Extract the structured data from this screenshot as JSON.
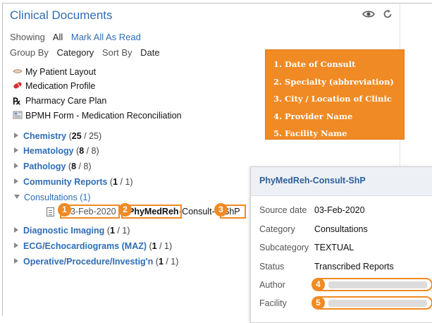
{
  "panel": {
    "title": "Clinical Documents",
    "showing_label": "Showing",
    "showing_value": "All",
    "mark_all_read": "Mark All As Read",
    "group_by_label": "Group By",
    "group_by_value": "Category",
    "sort_by_label": "Sort By",
    "sort_by_value": "Date"
  },
  "quick_links": [
    {
      "label": "My Patient Layout",
      "icon": "eye-lens-icon"
    },
    {
      "label": "Medication Profile",
      "icon": "pill-icon"
    },
    {
      "label": "Pharmacy Care Plan",
      "icon": "rx-icon"
    },
    {
      "label": "BPMH Form - Medication Reconciliation",
      "icon": "form-icon"
    }
  ],
  "tree": {
    "chemistry": {
      "name": "Chemistry",
      "count": "(25 / 25)",
      "unread": "25",
      "total": " / 25)"
    },
    "hematology": {
      "name": "Hematology",
      "unread": "8",
      "total": " / 8)"
    },
    "pathology": {
      "name": "Pathology",
      "unread": "8",
      "total": " / 8)"
    },
    "community": {
      "name": "Community Reports",
      "unread": "1",
      "total": " / 1)"
    },
    "consultations": {
      "name": "Consultations (1)"
    },
    "diagnostic": {
      "name": "Diagnostic Imaging",
      "unread": "1",
      "total": " / 1)"
    },
    "ecg": {
      "name": "ECG/Echocardiograms (MAZ)",
      "unread": "1",
      "total": " / 1)"
    },
    "operative": {
      "name": "Operative/Procedure/Investig'n",
      "unread": "1",
      "total": " / 1)"
    }
  },
  "doc": {
    "date": "03-Feb-2020",
    "specialty": "PhyMedReh",
    "sep": "-Consult-",
    "location": "ShP"
  },
  "markers": [
    "1",
    "2",
    "3",
    "4",
    "5"
  ],
  "callout": [
    "1. Date of Consult",
    "2. Specialty (abbreviation)",
    "3. City / Location of Clinic",
    "4. Provider Name",
    "5. Facility Name"
  ],
  "popup": {
    "title": "PhyMedReh-Consult-ShP",
    "rows": [
      {
        "label": "Source date",
        "value": "03-Feb-2020"
      },
      {
        "label": "Category",
        "value": "Consultations"
      },
      {
        "label": "Subcategory",
        "value": "TEXTUAL"
      },
      {
        "label": "Status",
        "value": "Transcribed Reports"
      },
      {
        "label": "Author",
        "value": ""
      },
      {
        "label": "Facility",
        "value": ""
      }
    ]
  },
  "colors": {
    "accent": "#f08a24",
    "link": "#2f6db3"
  }
}
